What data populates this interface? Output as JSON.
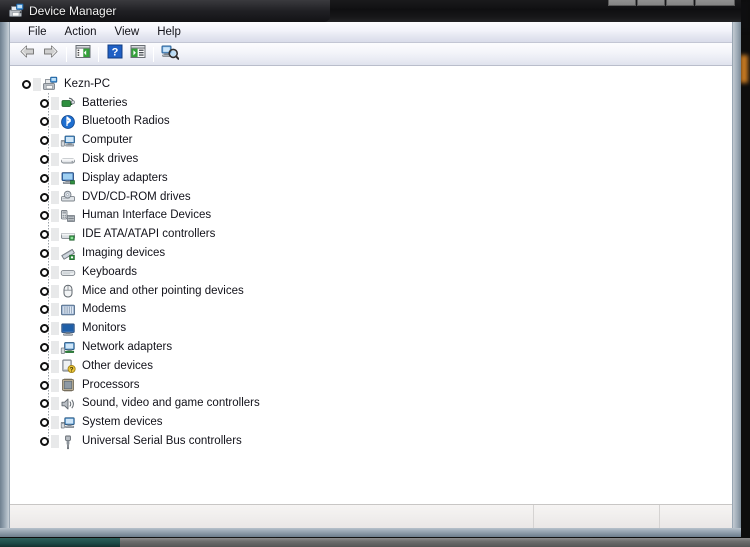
{
  "window": {
    "title": "Device Manager",
    "title_icon": "device-manager-icon",
    "caption_buttons": [
      {
        "name": "minimize",
        "label": ""
      },
      {
        "name": "maximize",
        "label": ""
      },
      {
        "name": "restore",
        "label": ""
      },
      {
        "name": "close",
        "label": ""
      }
    ]
  },
  "menubar": {
    "items": [
      {
        "label": "File"
      },
      {
        "label": "Action"
      },
      {
        "label": "View"
      },
      {
        "label": "Help"
      }
    ]
  },
  "toolbar": {
    "buttons": [
      {
        "name": "back",
        "icon": "back-arrow-icon",
        "label": "Back"
      },
      {
        "name": "forward",
        "icon": "forward-arrow-icon",
        "label": "Forward"
      },
      {
        "name": "sep1",
        "icon": "separator",
        "label": ""
      },
      {
        "name": "show-hide-tree",
        "icon": "console-tree-icon",
        "label": "Show/Hide Console Tree"
      },
      {
        "name": "sep2",
        "icon": "separator",
        "label": ""
      },
      {
        "name": "help",
        "icon": "help-question-icon",
        "label": "Help"
      },
      {
        "name": "properties",
        "icon": "properties-panel-icon",
        "label": "Properties"
      },
      {
        "name": "sep3",
        "icon": "separator",
        "label": ""
      },
      {
        "name": "scan-hardware",
        "icon": "scan-hardware-changes-icon",
        "label": "Scan for hardware changes"
      }
    ]
  },
  "tree": {
    "root": {
      "label": "Kezn-PC",
      "icon": "computer-root-icon",
      "expanded": true
    },
    "items": [
      {
        "label": "Batteries",
        "icon": "battery-icon"
      },
      {
        "label": "Bluetooth Radios",
        "icon": "bluetooth-icon"
      },
      {
        "label": "Computer",
        "icon": "computer-icon"
      },
      {
        "label": "Disk drives",
        "icon": "disk-drive-icon"
      },
      {
        "label": "Display adapters",
        "icon": "display-adapter-icon"
      },
      {
        "label": "DVD/CD-ROM drives",
        "icon": "dvd-drive-icon"
      },
      {
        "label": "Human Interface Devices",
        "icon": "hid-icon"
      },
      {
        "label": "IDE ATA/ATAPI controllers",
        "icon": "ide-controller-icon"
      },
      {
        "label": "Imaging devices",
        "icon": "imaging-device-icon"
      },
      {
        "label": "Keyboards",
        "icon": "keyboard-icon"
      },
      {
        "label": "Mice and other pointing devices",
        "icon": "mouse-icon"
      },
      {
        "label": "Modems",
        "icon": "modem-icon"
      },
      {
        "label": "Monitors",
        "icon": "monitor-icon"
      },
      {
        "label": "Network adapters",
        "icon": "network-adapter-icon"
      },
      {
        "label": "Other devices",
        "icon": "other-device-icon"
      },
      {
        "label": "Processors",
        "icon": "processor-icon"
      },
      {
        "label": "Sound, video and game controllers",
        "icon": "sound-controller-icon"
      },
      {
        "label": "System devices",
        "icon": "system-device-icon"
      },
      {
        "label": "Universal Serial Bus controllers",
        "icon": "usb-controller-icon"
      }
    ]
  },
  "statusbar": {
    "main": "",
    "panel_b": "",
    "panel_c": ""
  },
  "colors": {
    "titlebar": "#121214",
    "menubar": "#f2f3fa",
    "frame": "#9fadb9",
    "content_bg": "#ffffff",
    "status_bg": "#f0eeed",
    "text": "#12121a",
    "help_blue": "#1f5fc4"
  }
}
